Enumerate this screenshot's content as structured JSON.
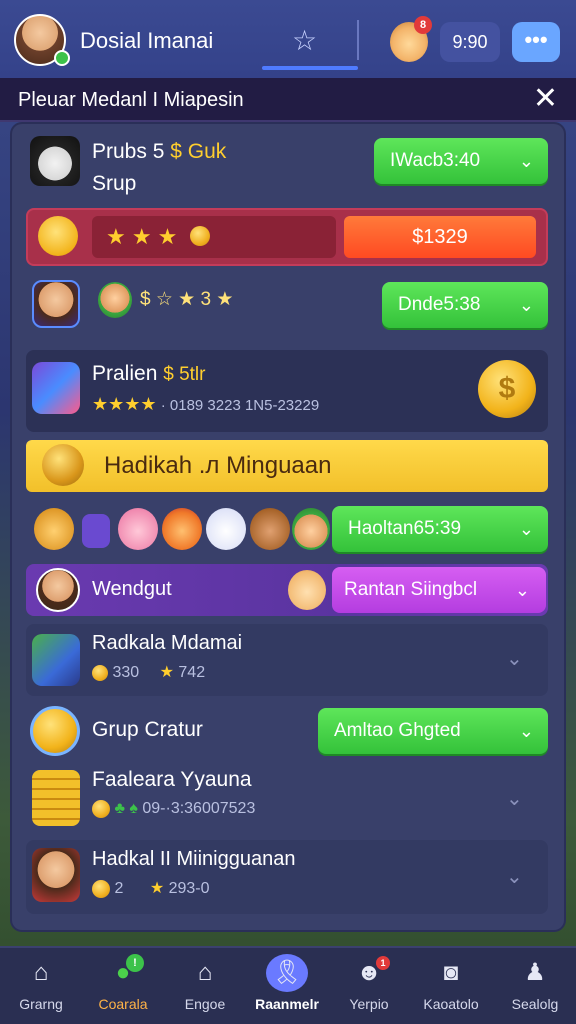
{
  "header": {
    "app_title": "Dosial Imanai",
    "star_tab_icon": "star-outline-icon",
    "time": "9:90",
    "more_icon": "ellipsis-icon",
    "more_label": "•••",
    "mascot_badge": "8"
  },
  "panel": {
    "title": "Pleuar Medanl I Miapesin",
    "close_label": "✕"
  },
  "rows": {
    "r1": {
      "name_line1": "Prubs 5",
      "name_tag": "$ Guk",
      "name_line2": "Srup",
      "button": "IWacb3:40",
      "chevron": "⌄"
    },
    "r2": {
      "stars": "★ ★ ★",
      "price": "$1329"
    },
    "r3": {
      "stars_text": "$ ☆ ★ 3 ★",
      "button": "Dnde5:38",
      "chevron": "⌄"
    },
    "r4": {
      "name": "Pralien",
      "tag": "$ 5tlr",
      "stars": "★★★★",
      "sub": "· 0189 3223 1N5-23229"
    },
    "banner": {
      "title": "Hadikah .л Minguaan"
    },
    "r6": {
      "button": "Haoltan65:39",
      "chevron": "⌄"
    },
    "r7": {
      "name": "Wendgut",
      "button": "Rantan Siingbcl",
      "chevron": "⌄"
    },
    "r8": {
      "name": "Radkala Mdamai",
      "sub_a": "330",
      "sub_b": "742",
      "chevron": "⌄"
    },
    "r9": {
      "name": "Grup Cratur",
      "button": "Amltao Ghgted",
      "chevron": "⌄"
    },
    "r10": {
      "name": "Faaleara Yyauna",
      "sub": "09-·3:36007523",
      "chevron": "⌄"
    },
    "r11": {
      "name": "Hadkal II Miinigguanan",
      "sub_a": "2",
      "sub_b": "293-0",
      "chevron": "⌄"
    }
  },
  "nav": {
    "items": [
      {
        "label": "Grarng",
        "icon": "home-icon"
      },
      {
        "label": "Coarala",
        "icon": "chat-icon"
      },
      {
        "label": "Engoe",
        "icon": "bank-icon"
      },
      {
        "label": "Raanmelr",
        "icon": "ribbon-icon"
      },
      {
        "label": "Yerpio",
        "icon": "face-icon"
      },
      {
        "label": "Kaoatolo",
        "icon": "instagram-icon"
      },
      {
        "label": "Sealolg",
        "icon": "profile-icon"
      }
    ],
    "badge_1": "!",
    "badge_4": "1"
  },
  "colors": {
    "accent_green": "#34c23a",
    "accent_purple": "#b43de0",
    "banner_yellow": "#f5c93a",
    "price_red": "#ff5a2a",
    "topbar": "#34428a"
  }
}
